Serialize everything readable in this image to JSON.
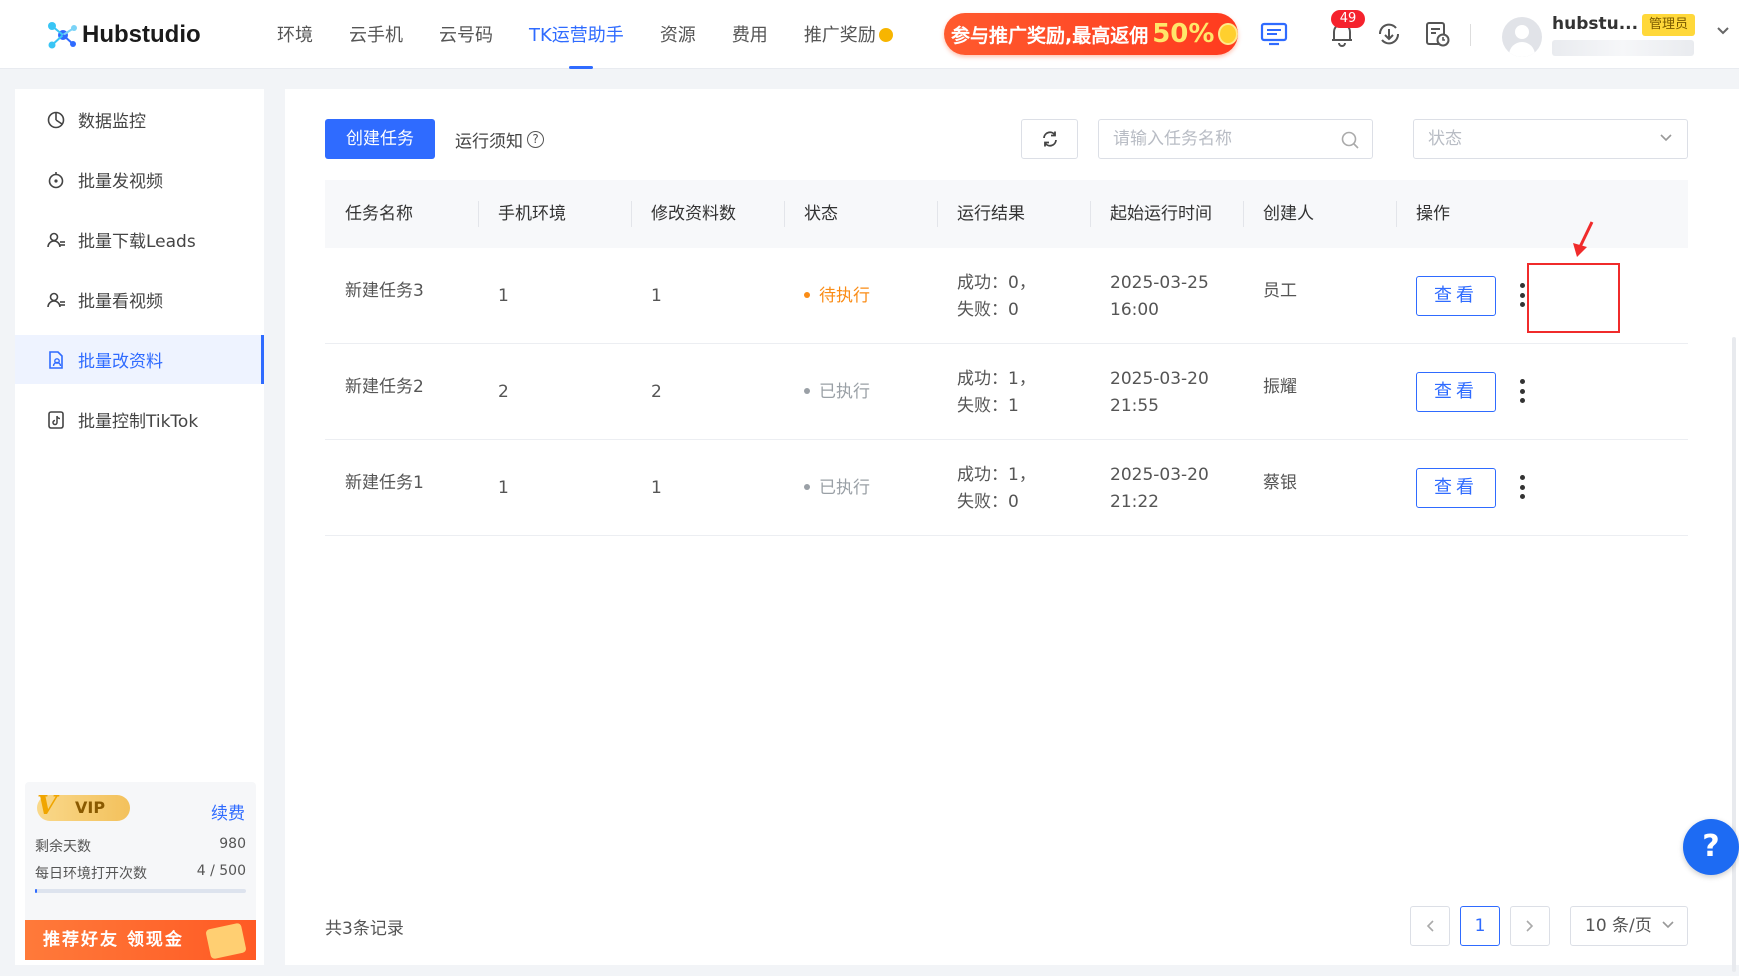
{
  "app": {
    "logo_text": "Hubstudio"
  },
  "nav": {
    "items": [
      {
        "label": "环境"
      },
      {
        "label": "云手机"
      },
      {
        "label": "云号码"
      },
      {
        "label": "TK运营助手",
        "active": true
      },
      {
        "label": "资源"
      },
      {
        "label": "费用"
      },
      {
        "label": "推广奖励"
      }
    ]
  },
  "promo": {
    "text": "参与推广奖励,最高返佣",
    "highlight": "50%"
  },
  "header": {
    "notification_count": "49",
    "username": "hubstu...",
    "role": "管理员"
  },
  "sidebar": {
    "items": [
      {
        "label": "数据监控",
        "icon": "chart-icon"
      },
      {
        "label": "批量发视频",
        "icon": "upload-video-icon"
      },
      {
        "label": "批量下载Leads",
        "icon": "users-icon"
      },
      {
        "label": "批量看视频",
        "icon": "users-icon"
      },
      {
        "label": "批量改资料",
        "icon": "edit-profile-icon",
        "active": true
      },
      {
        "label": "批量控制TikTok",
        "icon": "tiktok-icon"
      }
    ],
    "vip": {
      "badge": "VIP",
      "renew": "续费",
      "days_label": "剩余天数",
      "days_value": "980",
      "opens_label": "每日环境打开次数",
      "opens_value": "4 / 500",
      "opens_progress": 0.008,
      "refer_text": "推荐好友 领现金"
    }
  },
  "toolbar": {
    "create_label": "创建任务",
    "run_note_label": "运行须知",
    "search_placeholder": "请输入任务名称",
    "status_placeholder": "状态"
  },
  "table": {
    "columns": [
      "任务名称",
      "手机环境",
      "修改资料数",
      "状态",
      "运行结果",
      "起始运行时间",
      "创建人",
      "操作"
    ],
    "rows": [
      {
        "name": "新建任务3",
        "env": "1",
        "count": "1",
        "status": "待执行",
        "status_color": "#fa8c16",
        "result_success": "成功：0，",
        "result_fail": "失败：0",
        "date": "2025-03-25",
        "time": "16:00",
        "creator": "员工",
        "action": "查看"
      },
      {
        "name": "新建任务2",
        "env": "2",
        "count": "2",
        "status": "已执行",
        "status_color": "#9aa0a6",
        "result_success": "成功：1，",
        "result_fail": "失败：1",
        "date": "2025-03-20",
        "time": "21:55",
        "creator": "振耀",
        "action": "查看"
      },
      {
        "name": "新建任务1",
        "env": "1",
        "count": "1",
        "status": "已执行",
        "status_color": "#9aa0a6",
        "result_success": "成功：1，",
        "result_fail": "失败：0",
        "date": "2025-03-20",
        "time": "21:22",
        "creator": "蔡银",
        "action": "查看"
      }
    ]
  },
  "footer": {
    "total": "共3条记录",
    "current_page": "1",
    "page_size": "10 条/页"
  },
  "help": {
    "label": "?"
  },
  "colors": {
    "accent": "#2f6bff",
    "pending": "#fa8c16",
    "done": "#9aa0a6",
    "highlight_box": "#f02b2b"
  }
}
